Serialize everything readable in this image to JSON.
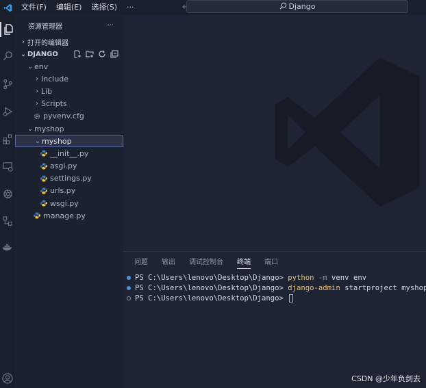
{
  "titlebar": {
    "menu": [
      "文件(F)",
      "编辑(E)",
      "选择(S)",
      "···"
    ],
    "search_text": "Django"
  },
  "sidebar": {
    "header_title": "资源管理器",
    "header_more": "···",
    "open_editors": "打开的编辑器",
    "project_name": "DJANGO",
    "tree": [
      {
        "label": "env",
        "indent": 1,
        "type": "folder-open"
      },
      {
        "label": "Include",
        "indent": 2,
        "type": "folder"
      },
      {
        "label": "Lib",
        "indent": 2,
        "type": "folder"
      },
      {
        "label": "Scripts",
        "indent": 2,
        "type": "folder"
      },
      {
        "label": "pyvenv.cfg",
        "indent": 2,
        "type": "cfg"
      },
      {
        "label": "myshop",
        "indent": 1,
        "type": "folder-open"
      },
      {
        "label": "myshop",
        "indent": 2,
        "type": "folder-open",
        "selected": true
      },
      {
        "label": "__init__.py",
        "indent": 3,
        "type": "py"
      },
      {
        "label": "asgi.py",
        "indent": 3,
        "type": "py"
      },
      {
        "label": "settings.py",
        "indent": 3,
        "type": "py"
      },
      {
        "label": "urls.py",
        "indent": 3,
        "type": "py"
      },
      {
        "label": "wsgi.py",
        "indent": 3,
        "type": "py"
      },
      {
        "label": "manage.py",
        "indent": 2,
        "type": "py"
      }
    ]
  },
  "panel": {
    "tabs": [
      "问题",
      "输出",
      "调试控制台",
      "终端",
      "端口"
    ],
    "active_tab": "终端",
    "terminal": [
      {
        "prompt": "PS C:\\Users\\lenovo\\Desktop\\Django> ",
        "cmd": "python",
        "flag": "-m",
        "rest": " venv env",
        "status": "done"
      },
      {
        "prompt": "PS C:\\Users\\lenovo\\Desktop\\Django> ",
        "cmd": "django-admin",
        "flag": "",
        "rest": " startproject myshop",
        "status": "done"
      },
      {
        "prompt": "PS C:\\Users\\lenovo\\Desktop\\Django> ",
        "cmd": "",
        "flag": "",
        "rest": "",
        "status": "pending"
      }
    ]
  },
  "credit": "CSDN @少年负剑去",
  "colors": {
    "accent": "#4b8fd6",
    "command": "#e5c07b",
    "python_blue": "#3d7ab8",
    "python_yellow": "#f5c842"
  }
}
